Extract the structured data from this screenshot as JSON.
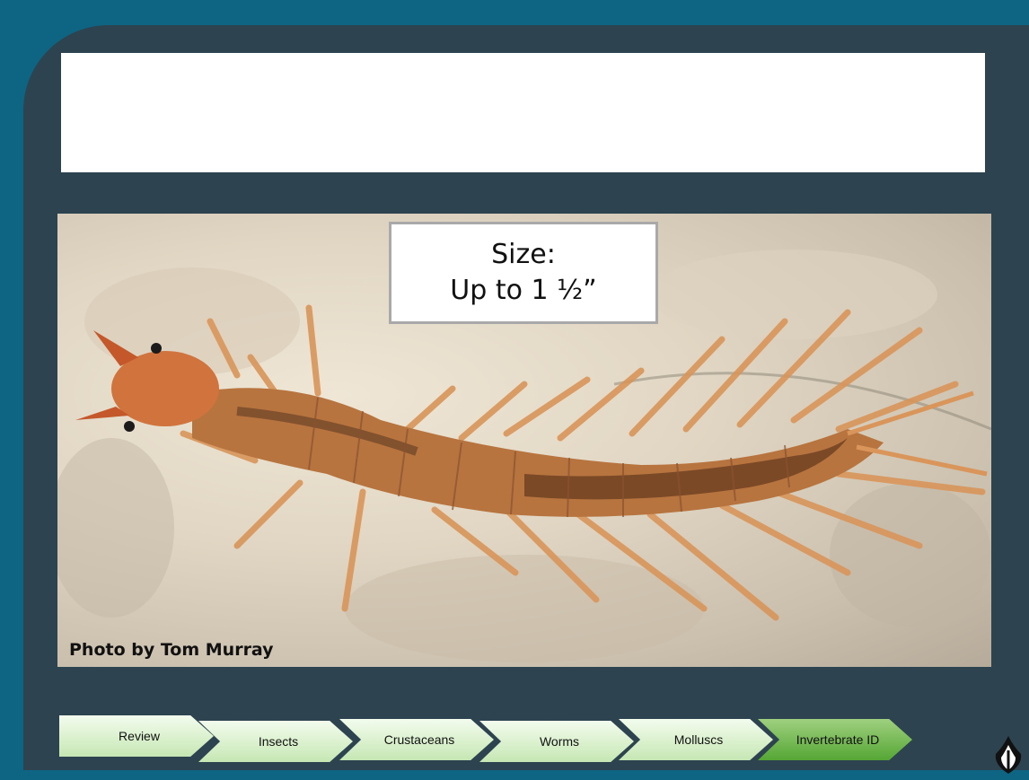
{
  "slide": {
    "title": "",
    "size_label": "Size:",
    "size_value": "Up to 1 ½”",
    "photo_credit": "Photo by Tom Murray",
    "photo_subject": "aquatic larva"
  },
  "nav": {
    "items": [
      {
        "label": "Review"
      },
      {
        "label": "Insects"
      },
      {
        "label": "Crustaceans"
      },
      {
        "label": "Worms"
      },
      {
        "label": "Molluscs"
      },
      {
        "label": "Invertebrate ID"
      }
    ]
  },
  "colors": {
    "background": "#0e6583",
    "panel": "#2d434f",
    "nav_light": "#c6e7b3",
    "nav_active": "#55a635"
  },
  "icons": {
    "logo": "shield-logo-icon"
  }
}
